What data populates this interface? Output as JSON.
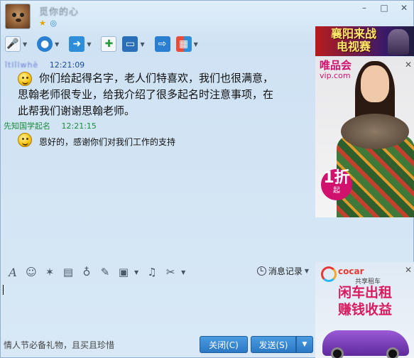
{
  "window": {
    "contact_name": "觅你的心",
    "controls": [
      "–",
      "□",
      "✕"
    ]
  },
  "toolbar": {
    "icons": [
      "microphone-icon",
      "video-call-icon",
      "file-transfer-icon",
      "add-chat-icon",
      "remote-desktop-icon",
      "share-screen-icon",
      "apps-icon"
    ]
  },
  "chat": {
    "messages": [
      {
        "sender": "ǐtlǐlwhè",
        "time": "12:21:09",
        "emoji": "grin",
        "lines": [
          "你们给起得名字，老人们特喜欢，我们也很满意，",
          "思翰老师很专业，给我介绍了很多起名时注意事项，在",
          "此帮我们谢谢思翰老师。"
        ]
      },
      {
        "sender": "先知国学起名",
        "time": "12:21:15",
        "emoji": "smile",
        "lines": [
          "恩好的，感谢你们对我们工作的支持"
        ]
      }
    ]
  },
  "input_toolbar": {
    "font_glyph": "A",
    "history_label": "消息记录"
  },
  "bottom": {
    "tip": "情人节必备礼物，且买且珍惜",
    "close_label": "关闭(C)",
    "send_label": "发送(S)"
  },
  "ads": {
    "top_banner": [
      "襄阳来战",
      "电视赛"
    ],
    "vip_logo": "唯品会",
    "vip_domain": "vip.com",
    "badge_num": "1折",
    "badge_txt": "起",
    "cocar_logo": "cocar",
    "cocar_sub": "共享租车",
    "cocar_line1": "闲车出租",
    "cocar_line2": "赚钱收益"
  },
  "colors": {
    "accent": "#2c78c4",
    "sender_green": "#1a8a3a",
    "time_blue": "#1a4a9a"
  }
}
